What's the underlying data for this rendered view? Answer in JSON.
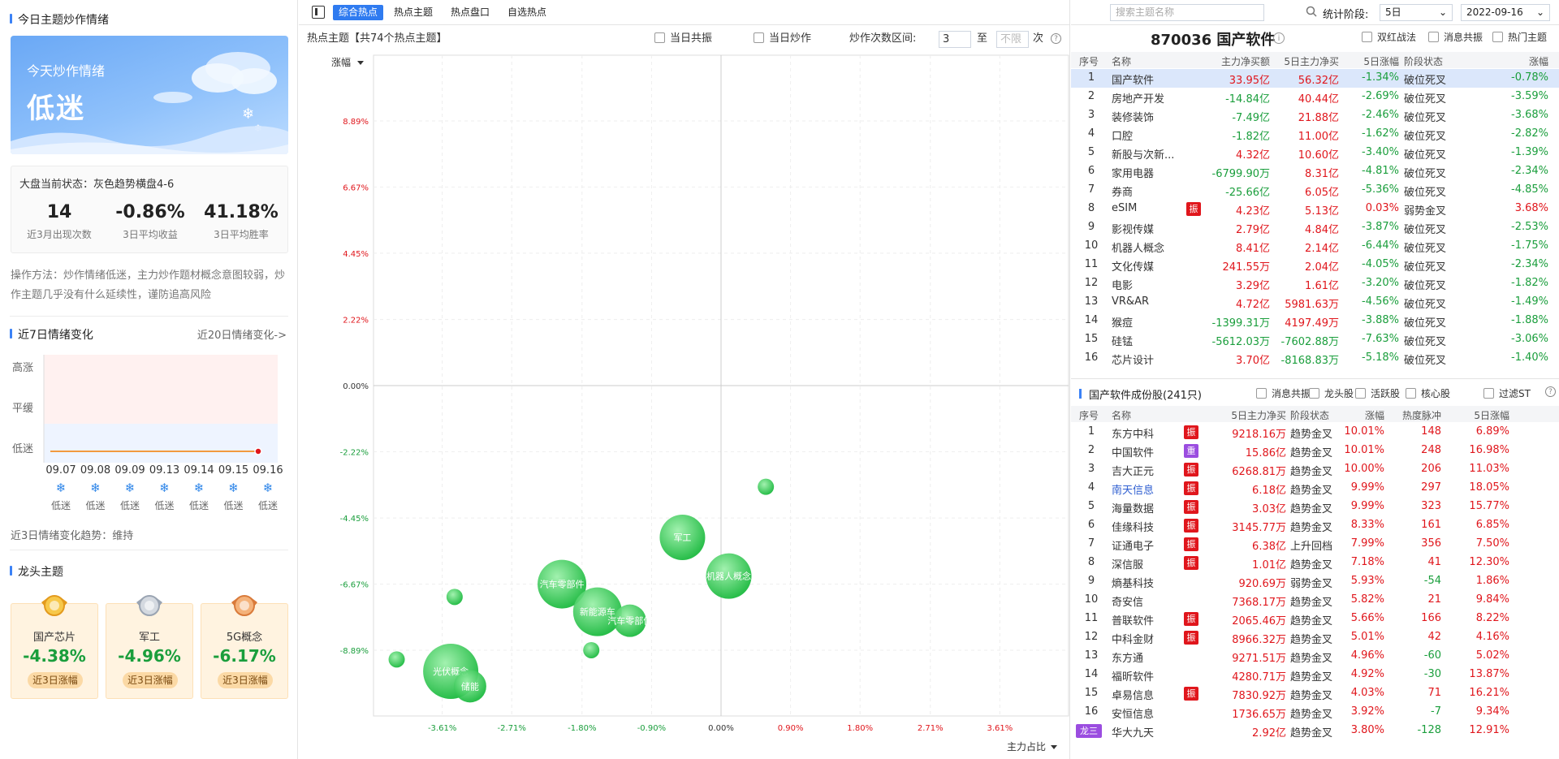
{
  "left": {
    "title": "今日主题炒作情绪",
    "mood_label": "今天炒作情绪",
    "mood_value": "低迷",
    "state": "大盘当前状态：灰色趋势横盘4-6",
    "stats": [
      {
        "v": "14",
        "l": "近3月出现次数"
      },
      {
        "v": "-0.86%",
        "l": "3日平均收益"
      },
      {
        "v": "41.18%",
        "l": "3日平均胜率"
      }
    ],
    "desc": "操作方法：炒作情绪低迷，主力炒作题材概念意图较弱，炒作主题几乎没有什么延续性，谨防追高风险",
    "mood7_title": "近7日情绪变化",
    "mood20_link": "近20日情绪变化->",
    "levels": [
      "高涨",
      "平缓",
      "低迷"
    ],
    "days": [
      {
        "d": "09.07",
        "s": "低迷"
      },
      {
        "d": "09.08",
        "s": "低迷"
      },
      {
        "d": "09.09",
        "s": "低迷"
      },
      {
        "d": "09.13",
        "s": "低迷"
      },
      {
        "d": "09.14",
        "s": "低迷"
      },
      {
        "d": "09.15",
        "s": "低迷"
      },
      {
        "d": "09.16",
        "s": "低迷"
      }
    ],
    "trend": "近3日情绪变化趋势：维持",
    "dragon_title": "龙头主题",
    "dragons": [
      {
        "name": "国产芯片",
        "pct": "-4.38%",
        "tag": "近3日涨幅",
        "medal": "gold"
      },
      {
        "name": "军工",
        "pct": "-4.96%",
        "tag": "近3日涨幅",
        "medal": "silver"
      },
      {
        "name": "5G概念",
        "pct": "-6.17%",
        "tag": "近3日涨幅",
        "medal": "bronze"
      }
    ]
  },
  "toolbar": {
    "tabs": [
      "综合热点",
      "热点主题",
      "热点盘口",
      "自选热点"
    ],
    "active": 0
  },
  "mid": {
    "title": "热点主题【共74个热点主题】",
    "cb1": "当日共振",
    "cb2": "当日炒作",
    "range_label": "炒作次数区间:",
    "range_from": "3",
    "range_to_label": "至",
    "range_to_ph": "不限",
    "range_unit": "次",
    "y_label": "涨幅",
    "x_label": "主力占比",
    "y_ticks": [
      "8.89%",
      "6.67%",
      "4.45%",
      "2.22%",
      "0.00%",
      "-2.22%",
      "-4.45%",
      "-6.67%",
      "-8.89%"
    ],
    "x_ticks": [
      "-3.61%",
      "-2.71%",
      "-1.80%",
      "-0.90%",
      "0.00%",
      "0.90%",
      "1.80%",
      "2.71%",
      "3.61%"
    ]
  },
  "chart_data": {
    "type": "scatter",
    "xlabel": "主力占比",
    "ylabel": "涨幅",
    "xlim": [
      -4.5,
      4.5
    ],
    "ylim": [
      -11.1,
      11.1
    ],
    "points": [
      {
        "x": 0.58,
        "y": -3.4,
        "r": 10,
        "label": ""
      },
      {
        "x": -0.5,
        "y": -5.1,
        "r": 28,
        "label": "军工"
      },
      {
        "x": 0.1,
        "y": -6.4,
        "r": 28,
        "label": "机器人概念"
      },
      {
        "x": -2.06,
        "y": -6.67,
        "r": 30,
        "label": "汽车零部件"
      },
      {
        "x": -1.6,
        "y": -7.6,
        "r": 30,
        "label": "新能源车"
      },
      {
        "x": -1.18,
        "y": -7.9,
        "r": 20,
        "label": "汽车零部件"
      },
      {
        "x": -3.45,
        "y": -7.1,
        "r": 10,
        "label": ""
      },
      {
        "x": -1.68,
        "y": -8.89,
        "r": 10,
        "label": ""
      },
      {
        "x": -4.2,
        "y": -9.2,
        "r": 10,
        "label": ""
      },
      {
        "x": -3.5,
        "y": -9.6,
        "r": 34,
        "label": "光伏概念"
      },
      {
        "x": -3.25,
        "y": -10.1,
        "r": 20,
        "label": "储能"
      }
    ]
  },
  "right": {
    "search_ph": "搜索主题名称",
    "stat_label": "统计阶段:",
    "stat_value": "5日",
    "date": "2022-09-16",
    "theme_title": "870036 国产软件",
    "opts": [
      "双红战法",
      "消息共振",
      "热门主题"
    ],
    "cols1": [
      "序号",
      "名称",
      "主力净买额",
      "5日主力净买",
      "5日涨幅",
      "阶段状态",
      "涨幅"
    ],
    "rows1": [
      [
        "1",
        "国产软件",
        "",
        "33.95亿",
        "56.32亿",
        "-1.34%",
        "破位死叉",
        "-0.78%"
      ],
      [
        "2",
        "房地产开发",
        "",
        "-14.84亿",
        "40.44亿",
        "-2.69%",
        "破位死叉",
        "-3.59%"
      ],
      [
        "3",
        "装修装饰",
        "",
        "-7.49亿",
        "21.88亿",
        "-2.46%",
        "破位死叉",
        "-3.68%"
      ],
      [
        "4",
        "口腔",
        "",
        "-1.82亿",
        "11.00亿",
        "-1.62%",
        "破位死叉",
        "-2.82%"
      ],
      [
        "5",
        "新股与次新...",
        "",
        "4.32亿",
        "10.60亿",
        "-3.40%",
        "破位死叉",
        "-1.39%"
      ],
      [
        "6",
        "家用电器",
        "",
        "-6799.90万",
        "8.31亿",
        "-4.81%",
        "破位死叉",
        "-2.34%"
      ],
      [
        "7",
        "券商",
        "",
        "-25.66亿",
        "6.05亿",
        "-5.36%",
        "破位死叉",
        "-4.85%"
      ],
      [
        "8",
        "eSIM",
        "振",
        "4.23亿",
        "5.13亿",
        "0.03%",
        "弱势金叉",
        "3.68%"
      ],
      [
        "9",
        "影视传媒",
        "",
        "2.79亿",
        "4.84亿",
        "-3.87%",
        "破位死叉",
        "-2.53%"
      ],
      [
        "10",
        "机器人概念",
        "",
        "8.41亿",
        "2.14亿",
        "-6.44%",
        "破位死叉",
        "-1.75%"
      ],
      [
        "11",
        "文化传媒",
        "",
        "241.55万",
        "2.04亿",
        "-4.05%",
        "破位死叉",
        "-2.34%"
      ],
      [
        "12",
        "电影",
        "",
        "3.29亿",
        "1.61亿",
        "-3.20%",
        "破位死叉",
        "-1.82%"
      ],
      [
        "13",
        "VR&AR",
        "",
        "4.72亿",
        "5981.63万",
        "-4.56%",
        "破位死叉",
        "-1.49%"
      ],
      [
        "14",
        "猴痘",
        "",
        "-1399.31万",
        "4197.49万",
        "-3.88%",
        "破位死叉",
        "-1.88%"
      ],
      [
        "15",
        "硅锰",
        "",
        "-5612.03万",
        "-7602.88万",
        "-7.63%",
        "破位死叉",
        "-3.06%"
      ],
      [
        "16",
        "芯片设计",
        "",
        "3.70亿",
        "-8168.83万",
        "-5.18%",
        "破位死叉",
        "-1.40%"
      ]
    ],
    "sub_title": "国产软件成份股(241只)",
    "opts2": [
      "消息共振",
      "龙头股",
      "活跃股",
      "核心股",
      "过滤ST"
    ],
    "cols2": [
      "序号",
      "名称",
      "5日主力净买",
      "阶段状态",
      "涨幅",
      "热度脉冲",
      "5日涨幅"
    ],
    "rows2": [
      [
        "1",
        "东方中科",
        "振",
        "9218.16万",
        "趋势金叉",
        "10.01%",
        "148",
        "6.89%"
      ],
      [
        "2",
        "中国软件",
        "重",
        "15.86亿",
        "趋势金叉",
        "10.01%",
        "248",
        "16.98%"
      ],
      [
        "3",
        "吉大正元",
        "振",
        "6268.81万",
        "趋势金叉",
        "10.00%",
        "206",
        "11.03%"
      ],
      [
        "4",
        "南天信息",
        "振",
        "6.18亿",
        "趋势金叉",
        "9.99%",
        "297",
        "18.05%"
      ],
      [
        "5",
        "海量数据",
        "振",
        "3.03亿",
        "趋势金叉",
        "9.99%",
        "323",
        "15.77%"
      ],
      [
        "6",
        "佳缘科技",
        "振",
        "3145.77万",
        "趋势金叉",
        "8.33%",
        "161",
        "6.85%"
      ],
      [
        "7",
        "证通电子",
        "振",
        "6.38亿",
        "上升回档",
        "7.99%",
        "356",
        "7.50%"
      ],
      [
        "8",
        "深信服",
        "振",
        "1.01亿",
        "趋势金叉",
        "7.18%",
        "41",
        "12.30%"
      ],
      [
        "9",
        "熵基科技",
        "",
        "920.69万",
        "弱势金叉",
        "5.93%",
        "-54",
        "1.86%"
      ],
      [
        "10",
        "奇安信",
        "",
        "7368.17万",
        "趋势金叉",
        "5.82%",
        "21",
        "9.84%"
      ],
      [
        "11",
        "普联软件",
        "振",
        "2065.46万",
        "趋势金叉",
        "5.66%",
        "166",
        "8.22%"
      ],
      [
        "12",
        "中科金财",
        "振",
        "8966.32万",
        "趋势金叉",
        "5.01%",
        "42",
        "4.16%"
      ],
      [
        "13",
        "东方通",
        "",
        "9271.51万",
        "趋势金叉",
        "4.96%",
        "-60",
        "5.02%"
      ],
      [
        "14",
        "福昕软件",
        "",
        "4280.71万",
        "趋势金叉",
        "4.92%",
        "-30",
        "13.87%"
      ],
      [
        "15",
        "卓易信息",
        "振",
        "7830.92万",
        "趋势金叉",
        "4.03%",
        "71",
        "16.21%"
      ],
      [
        "16",
        "安恒信息",
        "",
        "1736.65万",
        "趋势金叉",
        "3.92%",
        "-7",
        "9.34%"
      ],
      [
        "龙三",
        "华大九天",
        "",
        "2.92亿",
        "趋势金叉",
        "3.80%",
        "-128",
        "12.91%"
      ]
    ],
    "colors": {
      "red": "#e0161c",
      "green": "#1a9e3c",
      "badge_red": "#e0161c",
      "badge_purple": "#9b4de0",
      "select_row": "#dbe7fb"
    }
  }
}
